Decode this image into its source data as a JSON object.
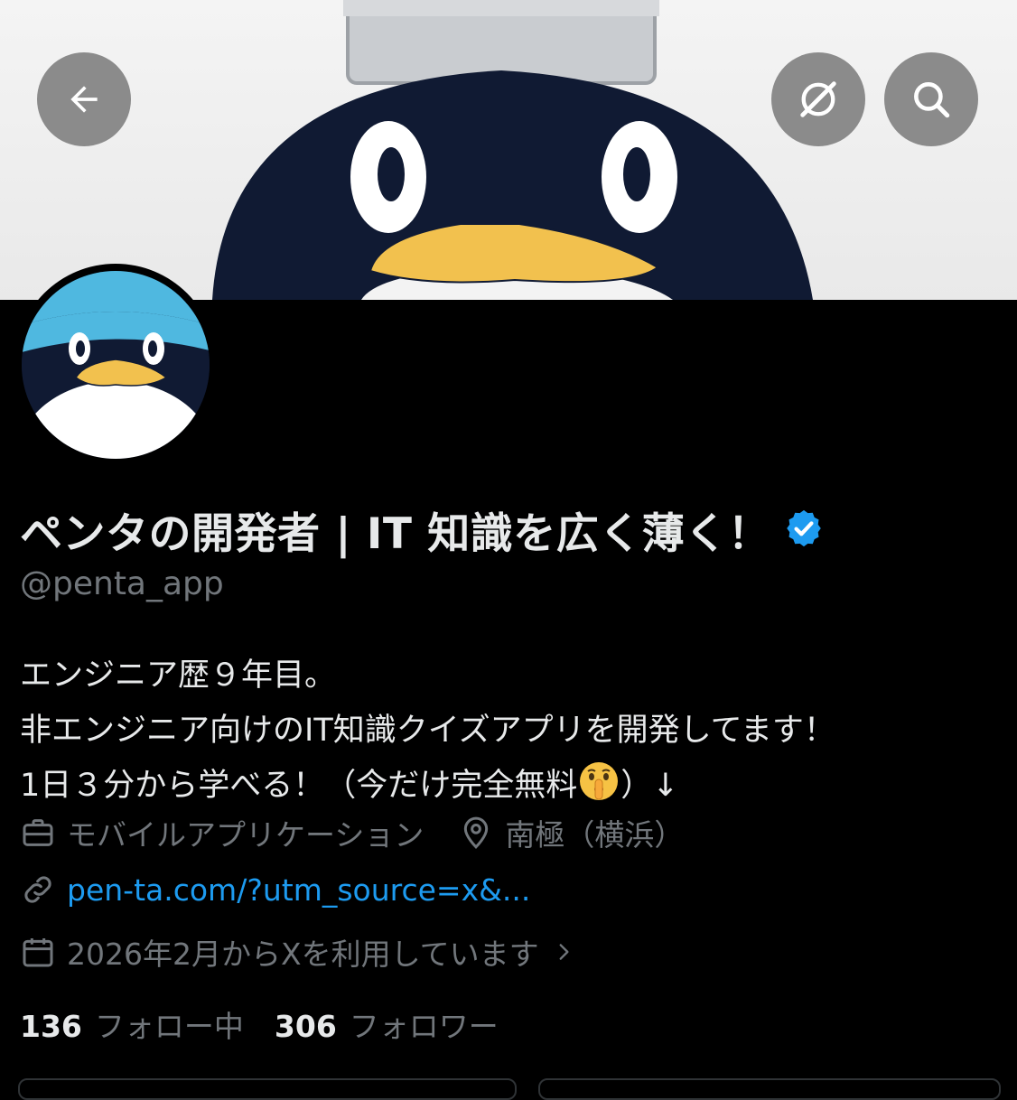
{
  "header": {
    "back_icon": "arrow-left-icon",
    "grok_icon": "grok-icon",
    "search_icon": "search-icon"
  },
  "profile": {
    "display_name": "ペンタの開発者 | IT 知識を広く薄く！",
    "verified_icon": "verified-badge-icon",
    "handle": "@penta_app",
    "bio_lines": [
      "エンジニア歴９年目。",
      "非エンジニア向けのIT知識クイズアプリを開発してます！",
      "1日３分から学べる！（今だけ完全無料",
      "）↓"
    ],
    "bio_emoji": "shushing-face-emoji",
    "category": "モバイルアプリケーション",
    "location": "南極（横浜）",
    "website": "pen-ta.com/?utm_source=x&...",
    "joined": "2026年2月からXを利用しています"
  },
  "stats": {
    "following_count": "136",
    "following_label": "フォロー中",
    "followers_count": "306",
    "followers_label": "フォロワー"
  },
  "colors": {
    "background": "#000000",
    "text_primary": "#e7e9ea",
    "text_secondary": "#71767b",
    "link": "#1d9bf0",
    "verified": "#1d9bf0",
    "penguin_navy": "#101a33",
    "penguin_beak": "#f2c14e",
    "avatar_cap": "#4fb8e0"
  }
}
